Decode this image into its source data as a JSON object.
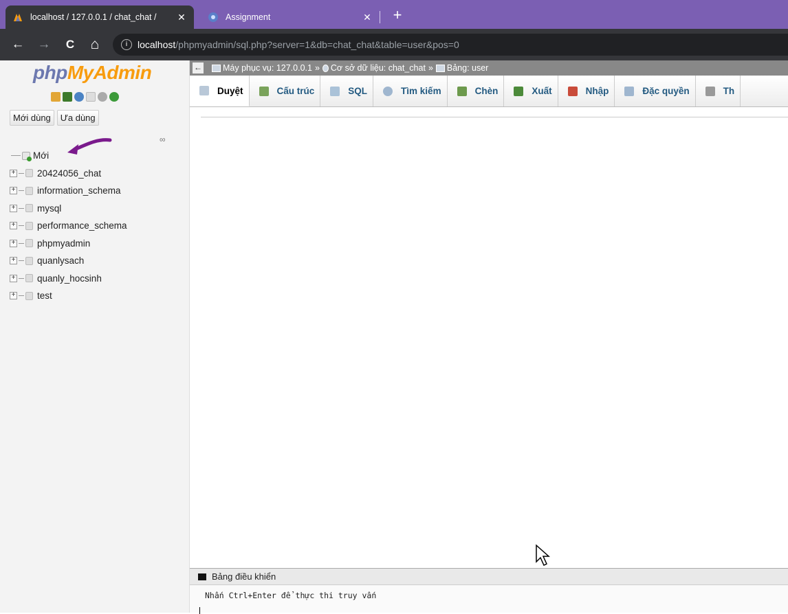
{
  "browser": {
    "tabs": [
      {
        "title": "localhost / 127.0.0.1 / chat_chat /",
        "close": "✕",
        "active": true
      },
      {
        "title": "Assignment",
        "close": "✕",
        "active": false
      }
    ],
    "newtab": "+",
    "nav": {
      "back": "←",
      "forward": "→",
      "reload": "C",
      "home": "⌂"
    },
    "url_host": "localhost",
    "url_path": "/phpmyadmin/sql.php?server=1&db=chat_chat&table=user&pos=0"
  },
  "sidebar": {
    "logo_php": "php",
    "logo_myadmin": "MyAdmin",
    "buttons": [
      "Mới dùng",
      "Ưa dùng"
    ],
    "new_item": "Mới",
    "databases": [
      "20424056_chat",
      "information_schema",
      "mysql",
      "performance_schema",
      "phpmyadmin",
      "quanlysach",
      "quanly_hocsinh",
      "test"
    ]
  },
  "breadcrumb": {
    "server": "Máy phục vụ: 127.0.0.1",
    "sep": "»",
    "database": "Cơ sở dữ liệu: chat_chat",
    "table": "Bảng: user"
  },
  "tabs": [
    {
      "label": "Duyệt",
      "icon": "browse-icon",
      "color": "#b9c8d8"
    },
    {
      "label": "Cấu trúc",
      "icon": "structure-icon",
      "color": "#7aa35b"
    },
    {
      "label": "SQL",
      "icon": "sql-icon",
      "color": "#aac2d8"
    },
    {
      "label": "Tìm kiếm",
      "icon": "search-icon",
      "color": "#9fb6cf"
    },
    {
      "label": "Chèn",
      "icon": "insert-icon",
      "color": "#6d9a4d"
    },
    {
      "label": "Xuất",
      "icon": "export-icon",
      "color": "#4c8a3a"
    },
    {
      "label": "Nhập",
      "icon": "import-icon",
      "color": "#c94b3a"
    },
    {
      "label": "Đặc quyền",
      "icon": "privileges-icon",
      "color": "#9fb6cf"
    },
    {
      "label": "Th",
      "icon": "operations-icon",
      "color": "#999999"
    }
  ],
  "console": {
    "title": "Bảng điều khiển",
    "hint": "Nhấn Ctrl+Enter để thực thi truy vấn"
  },
  "colors": {
    "tabbar": "#7b5fb3",
    "chrome": "#35363a",
    "link": "#235a81",
    "accent_orange": "#f89c0e"
  }
}
